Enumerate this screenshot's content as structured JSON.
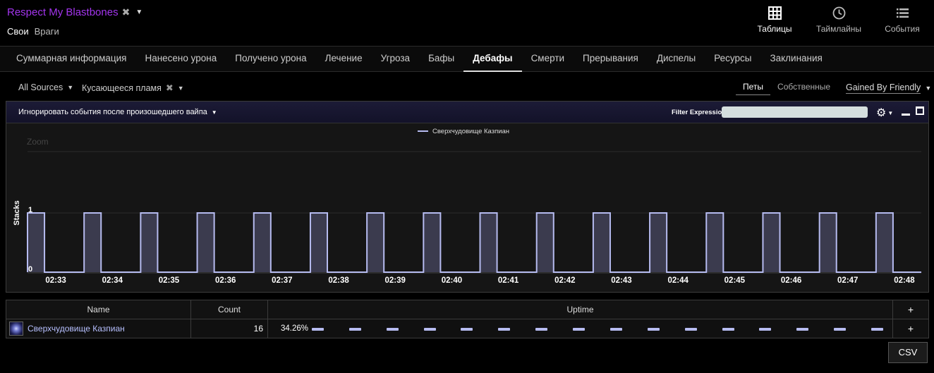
{
  "header": {
    "report_name": "Respect My Blastbones",
    "faction_tabs": [
      {
        "label": "Свои",
        "active": true
      },
      {
        "label": "Враги",
        "active": false
      }
    ],
    "views": [
      {
        "label": "Таблицы",
        "icon": "table-icon",
        "active": true
      },
      {
        "label": "Таймлайны",
        "icon": "clock-icon",
        "active": false
      },
      {
        "label": "События",
        "icon": "list-icon",
        "active": false
      }
    ]
  },
  "tabs": [
    {
      "label": "Суммарная информация",
      "active": false
    },
    {
      "label": "Нанесено урона",
      "active": false
    },
    {
      "label": "Получено урона",
      "active": false
    },
    {
      "label": "Лечение",
      "active": false
    },
    {
      "label": "Угроза",
      "active": false
    },
    {
      "label": "Бафы",
      "active": false
    },
    {
      "label": "Дебафы",
      "active": true
    },
    {
      "label": "Смерти",
      "active": false
    },
    {
      "label": "Прерывания",
      "active": false
    },
    {
      "label": "Диспелы",
      "active": false
    },
    {
      "label": "Ресурсы",
      "active": false
    },
    {
      "label": "Заклинания",
      "active": false
    }
  ],
  "filters": {
    "source": "All Sources",
    "ability": "Кусающееся пламя",
    "pets_on": "Петы",
    "pets_off": "Собственные",
    "gained_by": "Gained By Friendly"
  },
  "panel": {
    "ignore_label": "Игнорировать события после произошедшего вайпа",
    "filter_expression_label": "Filter Expression:",
    "filter_expression_value": ""
  },
  "chart_data": {
    "type": "area",
    "title": "",
    "zoom_label": "Zoom",
    "ylabel": "Stacks",
    "ylim": [
      0,
      1
    ],
    "y_ticks": [
      "0",
      "1"
    ],
    "x_ticks": [
      "02:33",
      "02:34",
      "02:35",
      "02:36",
      "02:37",
      "02:38",
      "02:39",
      "02:40",
      "02:41",
      "02:42",
      "02:43",
      "02:44",
      "02:45",
      "02:46",
      "02:47",
      "02:48"
    ],
    "xlim": [
      "02:32.5",
      "02:48.3"
    ],
    "series": [
      {
        "name": "Сверхчудовище Казпиан",
        "color": "#b6bbf0",
        "fill": "#3b3b4e",
        "intervals": [
          [
            "02:32.5",
            "02:32.8"
          ],
          [
            "02:33.5",
            "02:33.8"
          ],
          [
            "02:34.5",
            "02:34.8"
          ],
          [
            "02:35.5",
            "02:35.8"
          ],
          [
            "02:36.5",
            "02:36.8"
          ],
          [
            "02:37.5",
            "02:37.8"
          ],
          [
            "02:38.5",
            "02:38.8"
          ],
          [
            "02:39.5",
            "02:39.8"
          ],
          [
            "02:40.5",
            "02:40.8"
          ],
          [
            "02:41.5",
            "02:41.8"
          ],
          [
            "02:42.5",
            "02:42.8"
          ],
          [
            "02:43.5",
            "02:43.8"
          ],
          [
            "02:44.5",
            "02:44.8"
          ],
          [
            "02:45.5",
            "02:45.8"
          ],
          [
            "02:46.5",
            "02:46.8"
          ],
          [
            "02:47.5",
            "02:47.8"
          ]
        ]
      }
    ]
  },
  "table": {
    "headers": {
      "name": "Name",
      "count": "Count",
      "uptime": "Uptime",
      "plus": "+"
    },
    "rows": [
      {
        "name": "Сверхчудовище Казпиан",
        "icon": "creature-icon",
        "count": "16",
        "uptime": "34.26%",
        "plus": "+",
        "uptime_segments": 16
      }
    ]
  },
  "csv_label": "CSV"
}
